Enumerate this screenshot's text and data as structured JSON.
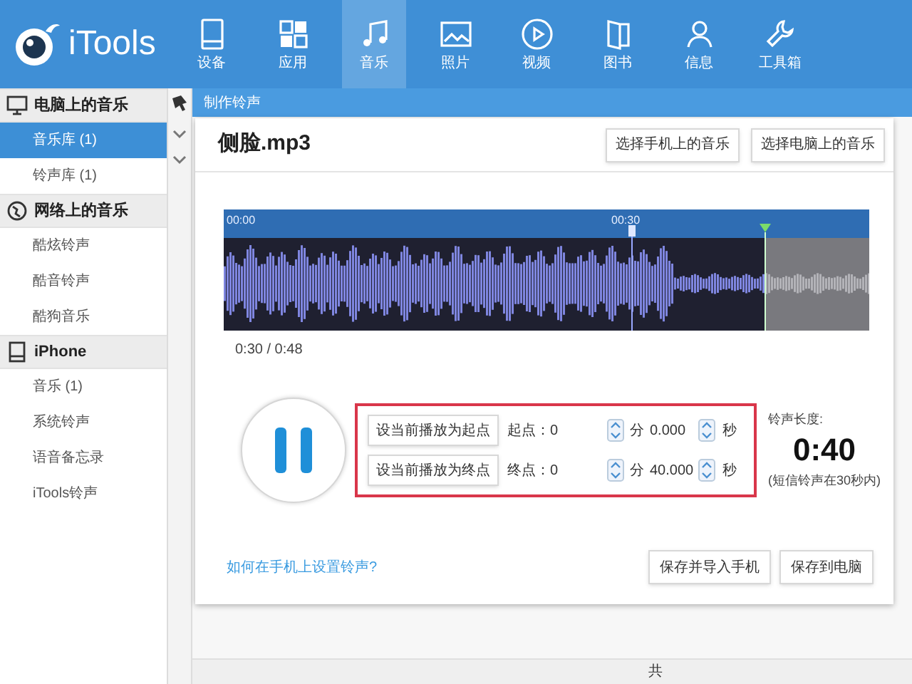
{
  "app": {
    "name": "iTools"
  },
  "nav": [
    {
      "label": "设备",
      "kind": "device",
      "selected": false
    },
    {
      "label": "应用",
      "kind": "apps",
      "selected": false
    },
    {
      "label": "音乐",
      "kind": "music",
      "selected": true
    },
    {
      "label": "照片",
      "kind": "photo",
      "selected": false
    },
    {
      "label": "视频",
      "kind": "video",
      "selected": false
    },
    {
      "label": "图书",
      "kind": "book",
      "selected": false
    },
    {
      "label": "信息",
      "kind": "contact",
      "selected": false
    },
    {
      "label": "工具箱",
      "kind": "tools",
      "selected": false
    }
  ],
  "sidebar": {
    "sections": [
      {
        "title": "电脑上的音乐",
        "kind": "computer",
        "items": [
          {
            "label": "音乐库 (1)",
            "selected": true
          },
          {
            "label": "铃声库 (1)",
            "selected": false
          }
        ]
      },
      {
        "title": "网络上的音乐",
        "kind": "globe",
        "items": [
          {
            "label": "酷炫铃声",
            "selected": false
          },
          {
            "label": "酷音铃声",
            "selected": false
          },
          {
            "label": "酷狗音乐",
            "selected": false
          }
        ]
      },
      {
        "title": "iPhone",
        "kind": "phone",
        "items": [
          {
            "label": "音乐 (1)",
            "selected": false
          },
          {
            "label": "系统铃声",
            "selected": false
          },
          {
            "label": "语音备忘录",
            "selected": false
          },
          {
            "label": "iTools铃声",
            "selected": false
          }
        ]
      }
    ]
  },
  "panel": {
    "title": "制作铃声"
  },
  "dialog": {
    "file_name": "侧脸.mp3",
    "source_buttons": [
      "选择手机上的音乐",
      "选择电脑上的音乐"
    ],
    "timeline": {
      "ticks": [
        "00:00",
        "00:30"
      ]
    },
    "time": "0:30 / 0:48",
    "playing": true,
    "points": [
      {
        "button": "设当前播放为起点",
        "label": "起点：",
        "minutes": "0",
        "minutes_unit": "分",
        "seconds": "0.000",
        "seconds_unit": "秒"
      },
      {
        "button": "设当前播放为终点",
        "label": "终点：",
        "minutes": "0",
        "minutes_unit": "分",
        "seconds": "40.000",
        "seconds_unit": "秒"
      }
    ],
    "length_label": "铃声长度:",
    "length": "0:40",
    "length_note": "(短信铃声在30秒内)",
    "help_link": "如何在手机上设置铃声?",
    "save_buttons": [
      "保存并导入手机",
      "保存到电脑"
    ]
  },
  "status_bar": {
    "text": "共"
  }
}
